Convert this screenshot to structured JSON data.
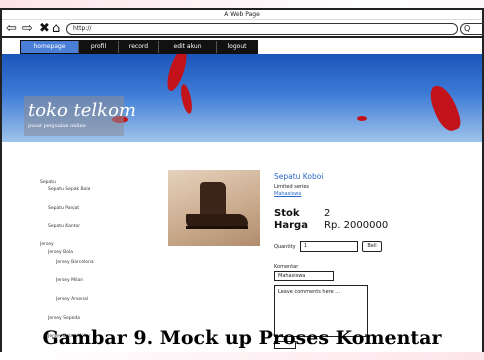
{
  "window": {
    "title": "A Web Page",
    "address": "http://",
    "search": "Q"
  },
  "nav_icons": {
    "back": "back-arrow-icon",
    "forward": "forward-arrow-icon",
    "stop": "close-icon",
    "home": "home-icon"
  },
  "menu": [
    {
      "label": "homepage"
    },
    {
      "label": "profil"
    },
    {
      "label": "record"
    },
    {
      "label": "edit akun"
    },
    {
      "label": "logout"
    }
  ],
  "brand": {
    "title": "toko telkom",
    "subtitle": "pusat penjualan online"
  },
  "sidebar": [
    {
      "label": "Sepatu"
    },
    {
      "label": "Sepatu Sepak Bola"
    },
    {
      "label": "Sepatu Panjat"
    },
    {
      "label": "Sepatu Kantor"
    },
    {
      "label": "Jersey"
    },
    {
      "label": "Jersey Bola"
    },
    {
      "label": "Jersey Barcelona"
    },
    {
      "label": "Jersey Milan"
    },
    {
      "label": "Jersey Arsenal"
    },
    {
      "label": "Jersey Sepeda"
    },
    {
      "label": "Jersey Balap Motor"
    }
  ],
  "product": {
    "title": "Sepatu Koboi",
    "series": "Limited series",
    "seller": "Mahasiswa",
    "stok_label": "Stok",
    "stok_value": "2",
    "harga_label": "Harga",
    "harga_value": "Rp. 2000000",
    "quantity_label": "Quantity",
    "quantity_value": "1",
    "buy_label": "Beli"
  },
  "komentar": {
    "label": "Komentar",
    "name_value": "Mahasiswa",
    "placeholder": "Leave comments here ..."
  },
  "caption": "Gambar 9. Mock up Proses Komentar",
  "colors": {
    "menu_active": "#4a7fd8",
    "banner": "#1c55b8",
    "link": "#2a66c8",
    "accent_red": "#c2121a"
  }
}
